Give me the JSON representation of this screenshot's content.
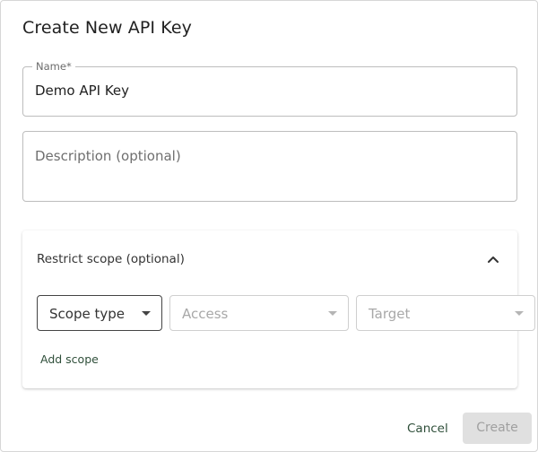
{
  "dialog": {
    "title": "Create New API Key"
  },
  "name_field": {
    "label": "Name",
    "required_marker": "*",
    "value": "Demo API Key"
  },
  "description_field": {
    "placeholder": "Description (optional)"
  },
  "scope": {
    "title": "Restrict scope (optional)",
    "expanded": true,
    "scope_type": {
      "placeholder": "Scope type"
    },
    "access": {
      "placeholder": "Access",
      "disabled": true
    },
    "target": {
      "placeholder": "Target",
      "disabled": true
    },
    "add_label": "Add scope"
  },
  "actions": {
    "cancel_label": "Cancel",
    "create_label": "Create",
    "create_disabled": true
  },
  "colors": {
    "accent": "#2f4f3a",
    "disabled_bg": "#e0e0e0",
    "disabled_text": "#a0a0a0"
  },
  "icons": {
    "collapse": "chevron-up-icon",
    "select_arrow": "caret-down-icon"
  }
}
